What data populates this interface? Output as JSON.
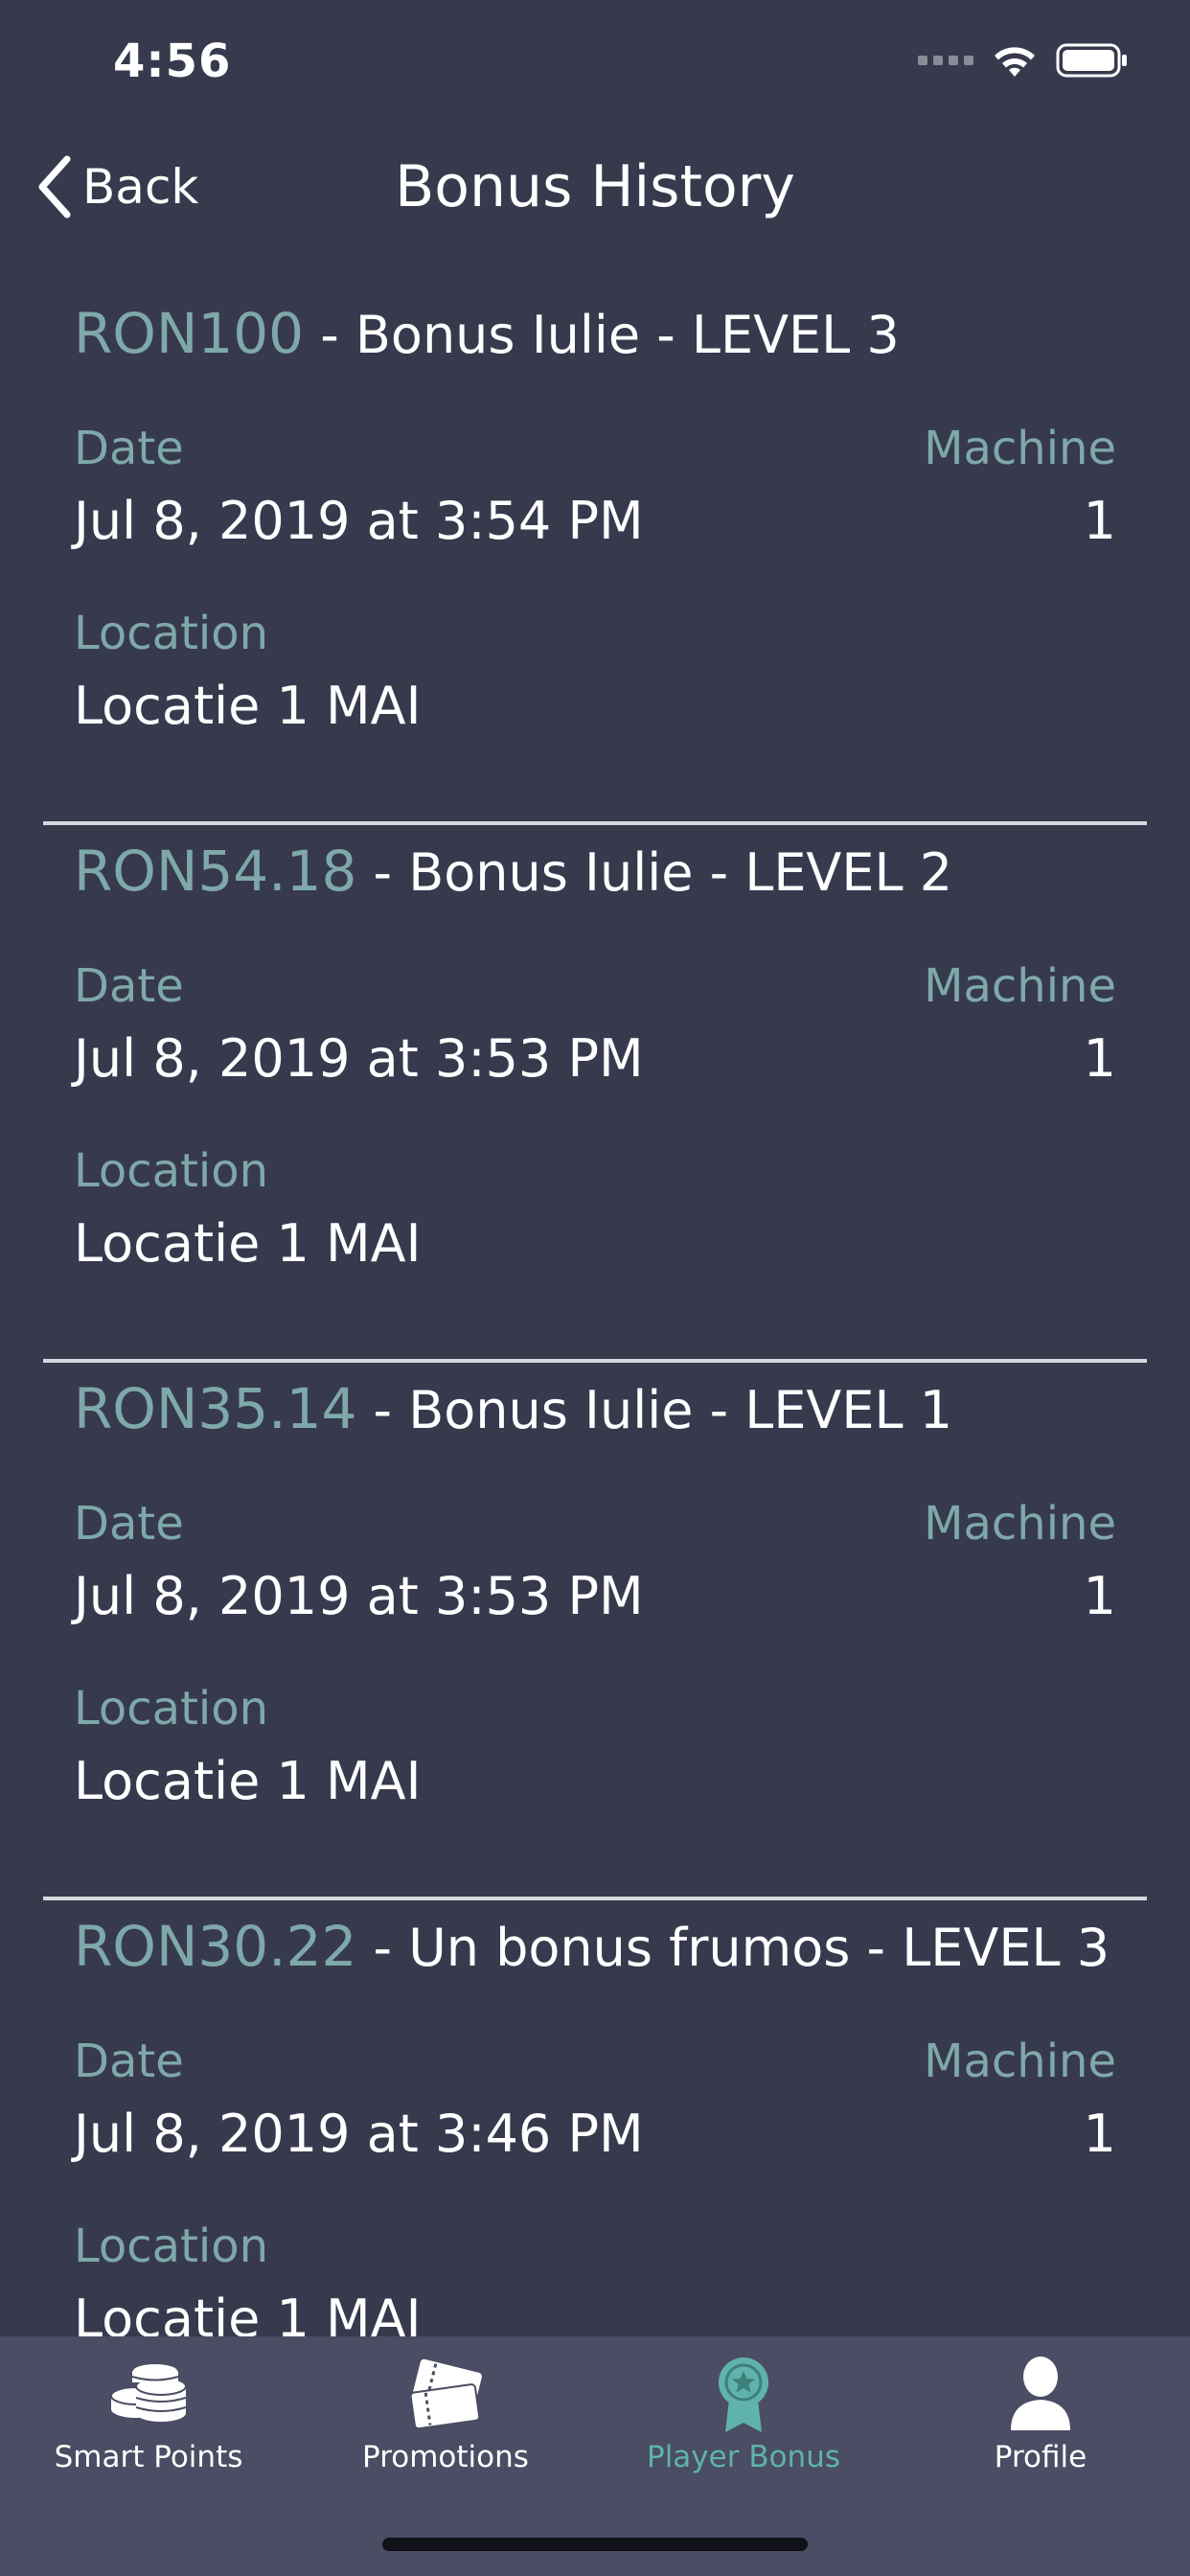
{
  "status_bar": {
    "time": "4:56"
  },
  "nav": {
    "back_label": "Back",
    "title": "Bonus History"
  },
  "labels": {
    "date": "Date",
    "machine": "Machine",
    "location": "Location"
  },
  "items": [
    {
      "amount": "RON100",
      "description": " - Bonus Iulie - LEVEL 3",
      "date": "Jul 8, 2019 at 3:54 PM",
      "machine": "1",
      "location": "Locatie 1 MAI"
    },
    {
      "amount": "RON54.18",
      "description": " - Bonus Iulie - LEVEL 2",
      "date": "Jul 8, 2019 at 3:53 PM",
      "machine": "1",
      "location": "Locatie 1 MAI"
    },
    {
      "amount": "RON35.14",
      "description": " - Bonus Iulie - LEVEL 1",
      "date": "Jul 8, 2019 at 3:53 PM",
      "machine": "1",
      "location": "Locatie 1 MAI"
    },
    {
      "amount": "RON30.22",
      "description": " - Un bonus frumos - LEVEL 3",
      "date": "Jul 8, 2019 at 3:46 PM",
      "machine": "1",
      "location": "Locatie 1 MAI"
    }
  ],
  "tabs": [
    {
      "label": "Smart Points",
      "icon": "coins-stack-icon",
      "active": false
    },
    {
      "label": "Promotions",
      "icon": "tickets-icon",
      "active": false
    },
    {
      "label": "Player Bonus",
      "icon": "award-badge-icon",
      "active": true
    },
    {
      "label": "Profile",
      "icon": "person-icon",
      "active": false
    }
  ],
  "colors": {
    "background": "#373a4d",
    "tab_bar": "#4a4d63",
    "accent": "#7fa8aa",
    "active_tab": "#5fb3ac"
  }
}
